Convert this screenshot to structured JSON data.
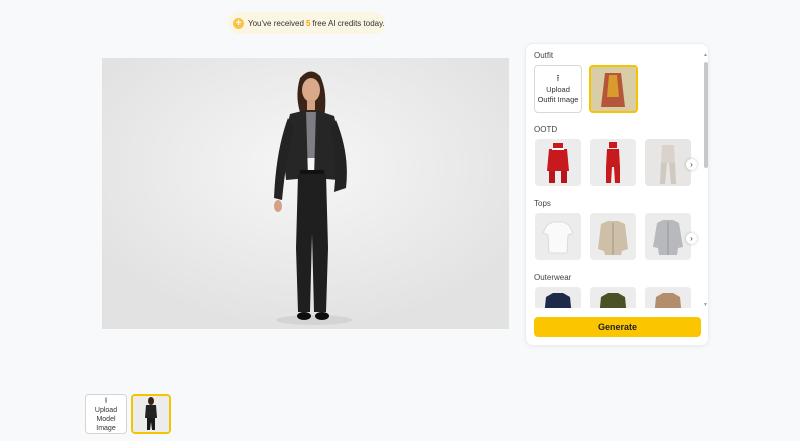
{
  "notice": {
    "icon": "coin-plus-icon",
    "prefix": "You've received",
    "count": "5",
    "suffix": "free AI credits today."
  },
  "panel": {
    "sections": {
      "outfit": "Outfit",
      "ootd": "OOTD",
      "tops": "Tops",
      "outerwear": "Outerwear"
    },
    "upload_outfit": {
      "icon": "upload-icon",
      "line1": "Upload",
      "line2": "Outfit Image"
    },
    "generate_label": "Generate"
  },
  "model": {
    "upload": {
      "icon": "upload-icon",
      "line1": "Upload",
      "line2": "Model Image"
    }
  },
  "colors": {
    "accent": "#fbc600",
    "selected_border": "#f5c400",
    "credits_highlight": "#f5a300"
  }
}
